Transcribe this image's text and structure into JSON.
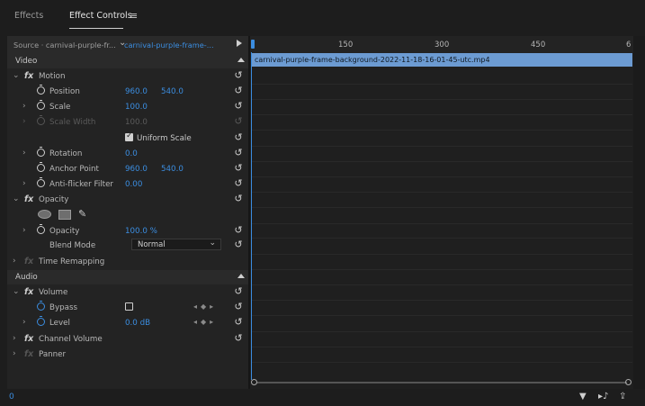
{
  "tabs": {
    "effects": "Effects",
    "effect_controls": "Effect Controls",
    "menu_glyph": "≡"
  },
  "source_bar": {
    "source": "Source · carnival-purple-fr...",
    "sequence": "carnival-purple-frame-..."
  },
  "sections": {
    "video": "Video",
    "audio": "Audio"
  },
  "motion": {
    "label": "Motion",
    "position": {
      "label": "Position",
      "x": "960.0",
      "y": "540.0"
    },
    "scale": {
      "label": "Scale",
      "value": "100.0"
    },
    "scale_width": {
      "label": "Scale Width",
      "value": "100.0"
    },
    "uniform_scale": {
      "label": "Uniform Scale",
      "checked": true
    },
    "rotation": {
      "label": "Rotation",
      "value": "0.0"
    },
    "anchor_point": {
      "label": "Anchor Point",
      "x": "960.0",
      "y": "540.0"
    },
    "anti_flicker": {
      "label": "Anti-flicker Filter",
      "value": "0.00"
    }
  },
  "opacity": {
    "label": "Opacity",
    "value_label": "Opacity",
    "value": "100.0 %",
    "blend_mode_label": "Blend Mode",
    "blend_mode_value": "Normal"
  },
  "time_remapping": {
    "label": "Time Remapping"
  },
  "volume": {
    "label": "Volume",
    "bypass": {
      "label": "Bypass",
      "checked": false
    },
    "level": {
      "label": "Level",
      "value": "0.0 dB"
    }
  },
  "channel_volume": {
    "label": "Channel Volume"
  },
  "panner": {
    "label": "Panner"
  },
  "timeline": {
    "ticks": [
      "150",
      "300",
      "450",
      "6"
    ],
    "clip_name": "carnival-purple-frame-background-2022-11-18-16-01-45-utc.mp4"
  },
  "bottom": {
    "timecode": "0"
  },
  "colors": {
    "accent_blue": "#3b8de0",
    "clip_bar": "#6c9bd2",
    "panel_bg": "#232323"
  }
}
